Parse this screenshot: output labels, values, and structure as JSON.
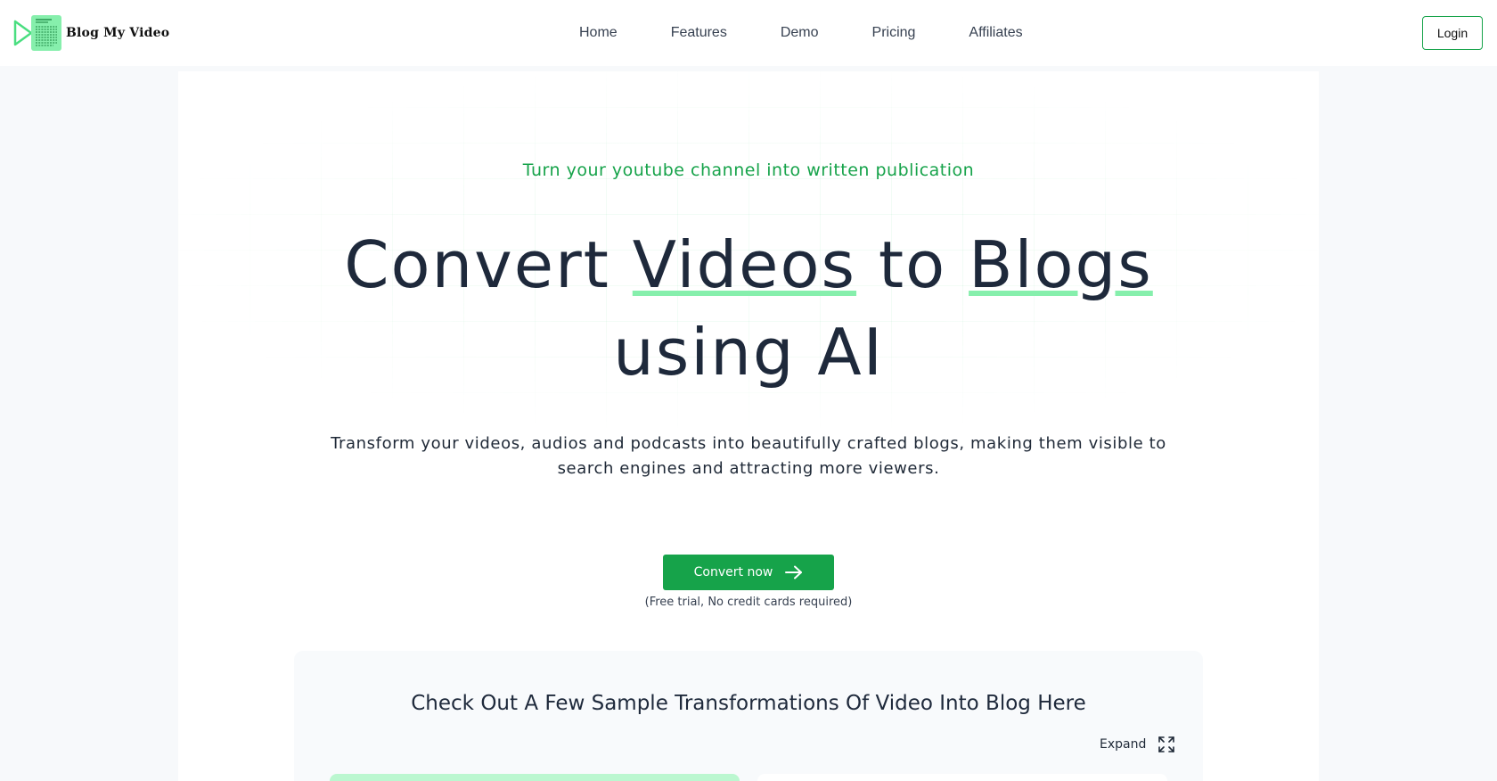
{
  "brand": {
    "name": "Blog My Video",
    "icon": "play-document-logo-icon",
    "colors": {
      "play": "#4ade80",
      "document": "#86efac"
    }
  },
  "nav": {
    "items": [
      {
        "label": "Home"
      },
      {
        "label": "Features"
      },
      {
        "label": "Demo"
      },
      {
        "label": "Pricing"
      },
      {
        "label": "Affiliates"
      }
    ],
    "login_label": "Login"
  },
  "hero": {
    "eyebrow": "Turn your youtube channel into written publication",
    "title_part1": "Convert ",
    "title_highlight1": "Videos",
    "title_part2": " to ",
    "title_highlight2": "Blogs",
    "title_line2": "using AI",
    "subtitle": "Transform your videos, audios and podcasts into beautifully crafted blogs, making them visible to search engines and attracting more viewers.",
    "cta_label": "Convert now",
    "cta_icon": "arrow-right-icon",
    "cta_note": "(Free trial, No credit cards required)"
  },
  "samples": {
    "title": "Check Out A Few Sample Transformations Of Video Into Blog Here",
    "expand_label": "Expand",
    "expand_icon": "expand-icon"
  },
  "colors": {
    "accent": "#16a34a",
    "underline": "#86efac",
    "heading": "#1e293b",
    "page_bg": "#f7f9fb"
  }
}
